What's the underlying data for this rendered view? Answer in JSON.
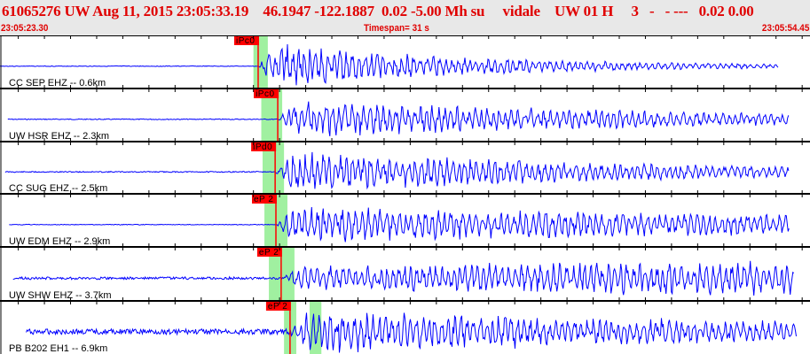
{
  "header": {
    "title": "61065276 UW Aug 11, 2015 23:05:33.19    46.1947 -122.1887  0.02 -5.00 Mh su     vidale    UW 01 H     3   -   - ---   0.02 0.00",
    "start_time": "23:05:23.30",
    "timespan": "Timespan=  31 s",
    "end_time": "23:05:54.45"
  },
  "timespan_s": 31,
  "colors": {
    "trace": "#0000ff",
    "pick": "#ff0000",
    "window": "#a0f0a0",
    "header_text": "#e00000"
  },
  "channels": [
    {
      "label": "CC SEP EHZ -- 0.6km",
      "pick": "iPc0",
      "pick_s": 9.88,
      "windows": [
        [
          9.7,
          10.25
        ]
      ],
      "trace_start_s": 0.0,
      "trace_end_s": 29.8,
      "amp": 1.0,
      "noise": 0.03,
      "decay": 0.12,
      "seed": 3
    },
    {
      "label": "UW HSR EHZ -- 2.3km",
      "pick": "iPc0",
      "pick_s": 10.63,
      "windows": [
        [
          10.0,
          10.8
        ]
      ],
      "trace_start_s": 0.3,
      "trace_end_s": 30.2,
      "amp": 0.8,
      "noise": 0.04,
      "decay": 0.06,
      "seed": 7
    },
    {
      "label": "CC SUG EHZ -- 2.5km",
      "pick": "iPd0",
      "pick_s": 10.53,
      "windows": [
        [
          10.05,
          10.87
        ]
      ],
      "trace_start_s": 0.2,
      "trace_end_s": 30.2,
      "amp": 0.9,
      "noise": 0.05,
      "decay": 0.07,
      "seed": 11
    },
    {
      "label": "UW EDM EHZ -- 2.9km",
      "pick": "eP 2",
      "pick_s": 10.56,
      "windows": [
        [
          10.12,
          11.0
        ]
      ],
      "trace_start_s": 0.35,
      "trace_end_s": 30.2,
      "amp": 0.75,
      "noise": 0.03,
      "decay": 0.03,
      "seed": 19
    },
    {
      "label": "UW SHW EHZ -- 3.7km",
      "pick": "eP 2",
      "pick_s": 10.76,
      "windows": [
        [
          10.29,
          11.27
        ]
      ],
      "trace_start_s": 0.5,
      "trace_end_s": 30.4,
      "amp": 0.8,
      "noise": 0.12,
      "decay": -0.02,
      "seed": 23
    },
    {
      "label": "PB B202 EH1 -- 6.9km",
      "pick": "eP 2",
      "pick_s": 11.1,
      "windows": [
        [
          10.87,
          11.34
        ],
        [
          11.85,
          12.3
        ]
      ],
      "trace_start_s": 1.0,
      "trace_end_s": 30.5,
      "amp": 0.9,
      "noise": 0.25,
      "decay": 0.04,
      "seed": 31
    }
  ]
}
